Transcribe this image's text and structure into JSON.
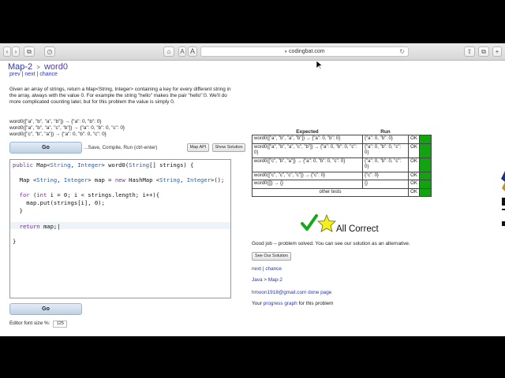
{
  "browser": {
    "url": "codingbat.com",
    "buttons": [
      "‹",
      "›",
      "⧉",
      "◷",
      "⌂",
      "◫",
      "⚙"
    ],
    "font_small": "A",
    "font_large": "A",
    "right_buttons": [
      "⇧",
      "⧉",
      "+"
    ]
  },
  "header": {
    "section": "Map-2",
    "sep": ">",
    "problem": "word0",
    "prev": "prev",
    "next": "next",
    "chance": "chance",
    "pipe": "|"
  },
  "description": "Given an array of strings, return a Map<String, Integer> containing a key for every different string in the array, always with the value 0. For example the string \"hello\" makes the pair \"hello\":0. We'll do more complicated counting later, but for this problem the value is simply 0.",
  "examples": [
    "word0([\"a\", \"b\", \"a\", \"b\"]) → {\"a\": 0, \"b\": 0}",
    "word0([\"a\", \"b\", \"a\", \"c\", \"b\"]) → {\"a\": 0, \"b\": 0, \"c\": 0}",
    "word0([\"c\", \"b\", \"a\"]) → {\"a\": 0, \"b\": 0, \"c\": 0}"
  ],
  "controls": {
    "go_label": "Go",
    "go_hint": "...Save, Compile, Run (ctrl-enter)",
    "map_api": "Map API",
    "show_solution": "Show Solution",
    "font_size_label": "Editor font size %:",
    "font_size_value": "125"
  },
  "results": {
    "headers": [
      "Expected",
      "Run"
    ],
    "rows": [
      {
        "expected": "word0([\"a\", \"b\", \"a\", \"b\"]) → {\"a\": 0, \"b\": 0}",
        "run": "{\"a\": 0, \"b\": 0}",
        "status": "OK"
      },
      {
        "expected": "word0([\"a\", \"b\", \"a\", \"c\", \"b\"]) → {\"a\": 0, \"b\": 0, \"c\": 0}",
        "run": "{\"a\": 0, \"b\": 0, \"c\": 0}",
        "status": "OK"
      },
      {
        "expected": "word0([\"c\", \"b\", \"a\"]) → {\"a\": 0, \"b\": 0, \"c\": 0}",
        "run": "{\"a\": 0, \"b\": 0, \"c\": 0}",
        "status": "OK"
      },
      {
        "expected": "word0([\"c\", \"c\", \"c\", \"c\"]) → {\"c\": 0}",
        "run": "{\"c\": 0}",
        "status": "OK"
      },
      {
        "expected": "word0([]) → {}",
        "run": "{}",
        "status": "OK"
      },
      {
        "expected": "other tests",
        "run": "",
        "status": "OK"
      }
    ],
    "pass_color": "#12a313"
  },
  "feedback": {
    "all_correct": "All Correct",
    "good_job": "Good job -- problem solved. You can see our solution as an alternative.",
    "see_solution": "See Our Solution",
    "next": "next",
    "chance": "chance",
    "pipe": "|",
    "crumb_java": "Java",
    "crumb_sep": ">",
    "crumb_map2": "Map-2",
    "done_page": "hmoon1918@gmail.com done page",
    "progress_prefix": "Your ",
    "progress_link": "progress graph",
    "progress_suffix": " for this problem"
  }
}
